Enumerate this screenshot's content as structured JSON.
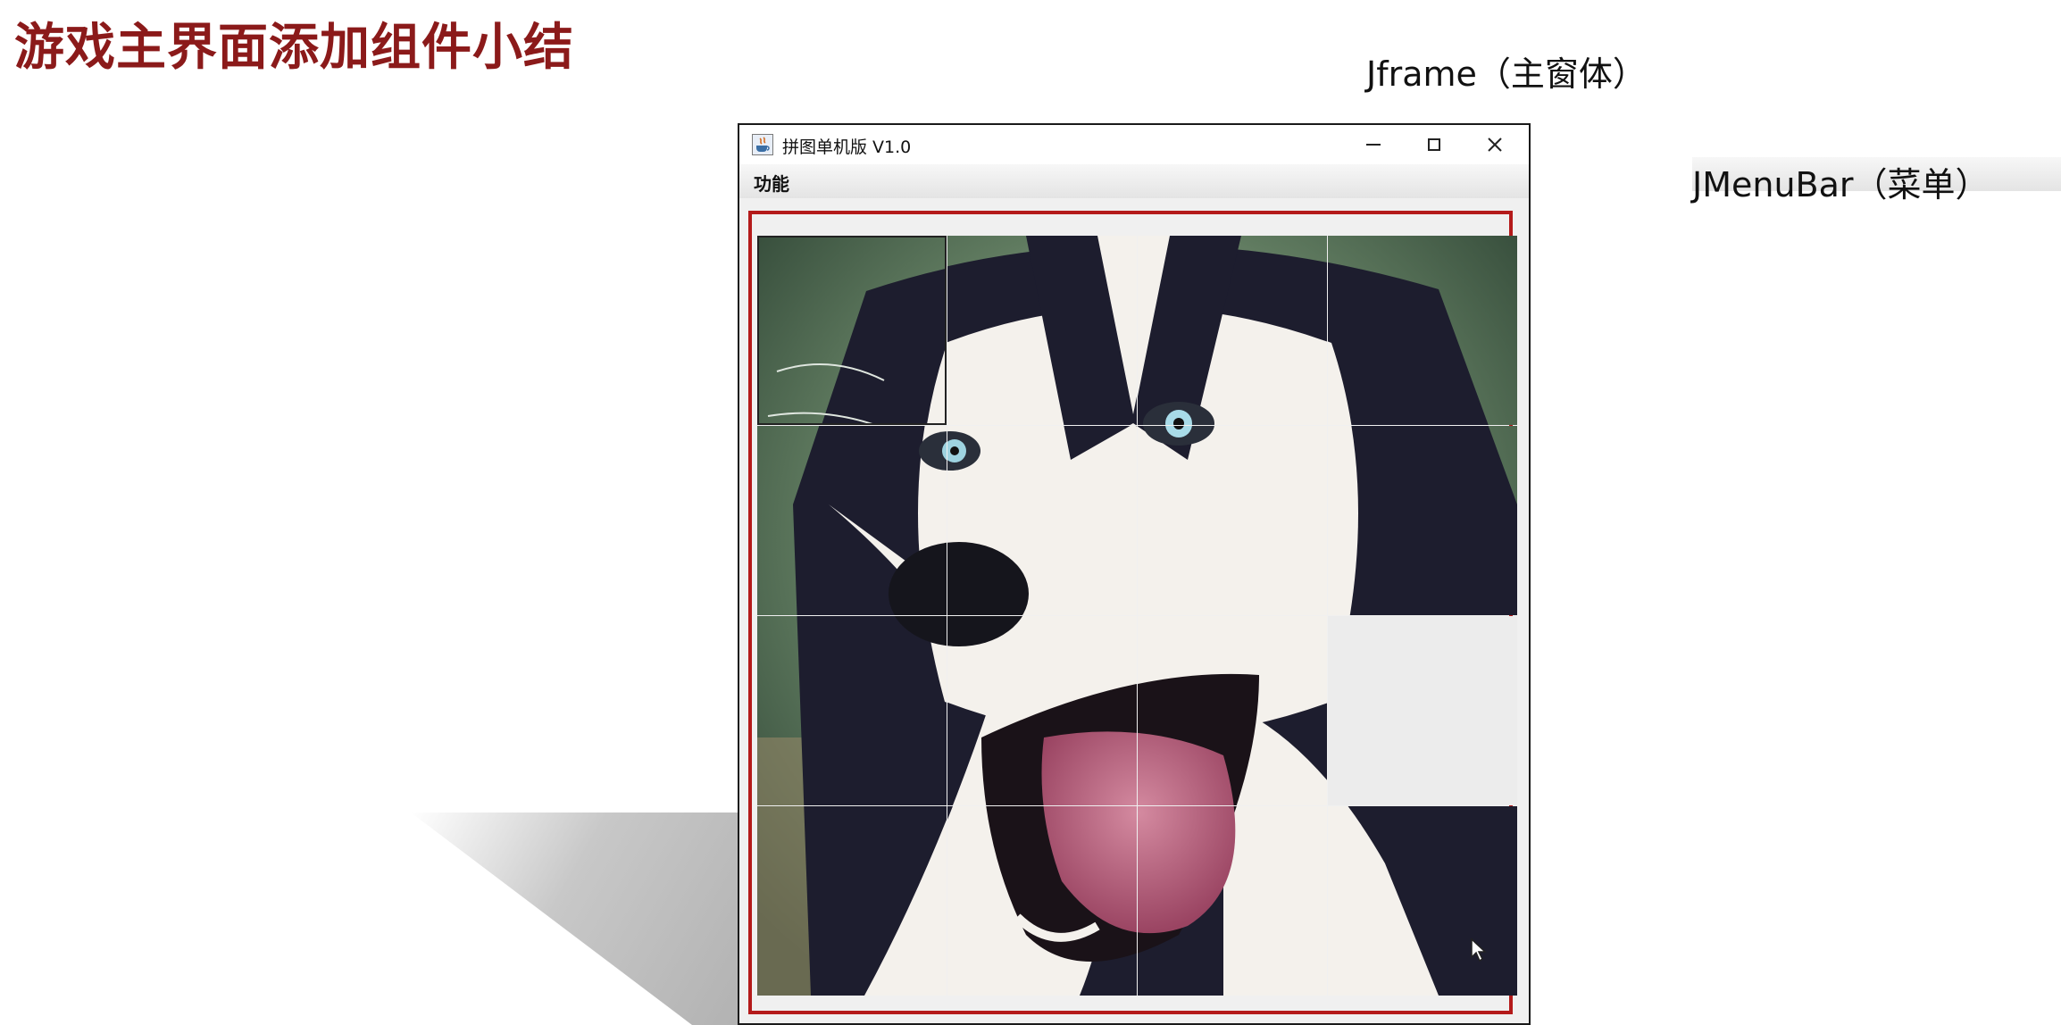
{
  "slide": {
    "title": "游戏主界面添加组件小结",
    "callout_frame": "Jframe（主窗体）",
    "callout_menubar": "JMenuBar（菜单）"
  },
  "window": {
    "title": "拼图单机版 V1.0",
    "menu": [
      {
        "label": "功能"
      }
    ]
  },
  "puzzle": {
    "grid": "4x4",
    "empty_tile_index": 11,
    "accent": "#b41a1a",
    "title_color": "#8b1a1a"
  }
}
